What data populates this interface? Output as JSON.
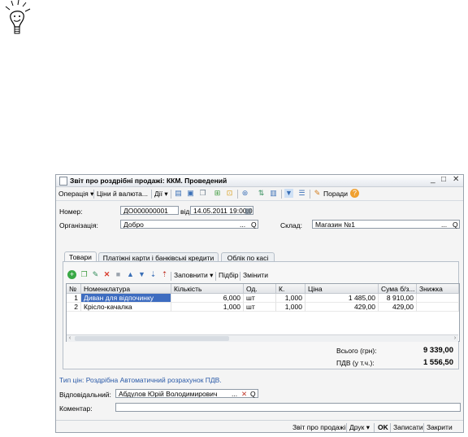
{
  "window": {
    "title": "Звіт про роздрібні продажі: ККМ. Проведений",
    "min": "_",
    "max": "□",
    "close": "✕"
  },
  "toolbar": {
    "operation": "Операція ▾",
    "prices": "Ціни й валюта...",
    "actions": "Дії ▾",
    "tips": "Поради",
    "help": "?"
  },
  "form": {
    "number_label": "Номер:",
    "number_value": "ДО000000001",
    "from_label": "від:",
    "date_value": "14.05.2011 19:00:00",
    "org_label": "Організація:",
    "org_value": "Добро",
    "warehouse_label": "Склад:",
    "warehouse_value": "Магазин №1",
    "ellipsis": "...",
    "q": "Q"
  },
  "tabs": [
    {
      "label": "Товари"
    },
    {
      "label": "Платіжні карти і банківські кредити"
    },
    {
      "label": "Облік по касі"
    }
  ],
  "grid_toolbar": {
    "fill": "Заповнити ▾",
    "select": "Підбір",
    "change": "Змінити"
  },
  "table": {
    "columns": [
      "№",
      "Номенклатура",
      "Кількість",
      "Од.",
      "К.",
      "Ціна",
      "Сума б/з...",
      "Знижка"
    ],
    "rows": [
      {
        "n": "1",
        "name": "Диван для відпочинку",
        "qty": "6,000",
        "unit": "шт",
        "k": "1,000",
        "price": "1 485,00",
        "sum": "8 910,00",
        "disc": ""
      },
      {
        "n": "2",
        "name": "Крісло-качалка",
        "qty": "1,000",
        "unit": "шт",
        "k": "1,000",
        "price": "429,00",
        "sum": "429,00",
        "disc": ""
      }
    ]
  },
  "totals": {
    "total_label": "Всього (грн):",
    "total_value": "9 339,00",
    "vat_label": "ПДВ (у т.ч.):",
    "vat_value": "1 556,50"
  },
  "price_type": "Тип цін: Роздрібна Автоматичний розрахунок ПДВ.",
  "responsible_label": "Відповідальний:",
  "responsible_value": "Абдулов Юрій Володимирович",
  "comment_label": "Коментар:",
  "comment_value": "",
  "bottom": {
    "report": "Звіт про продажі",
    "print": "Друк ▾",
    "ok": "OK",
    "save": "Записати",
    "close": "Закрити"
  },
  "colors": {
    "selected_row": "#3d6cc0",
    "link_text": "#2a5aa8"
  }
}
